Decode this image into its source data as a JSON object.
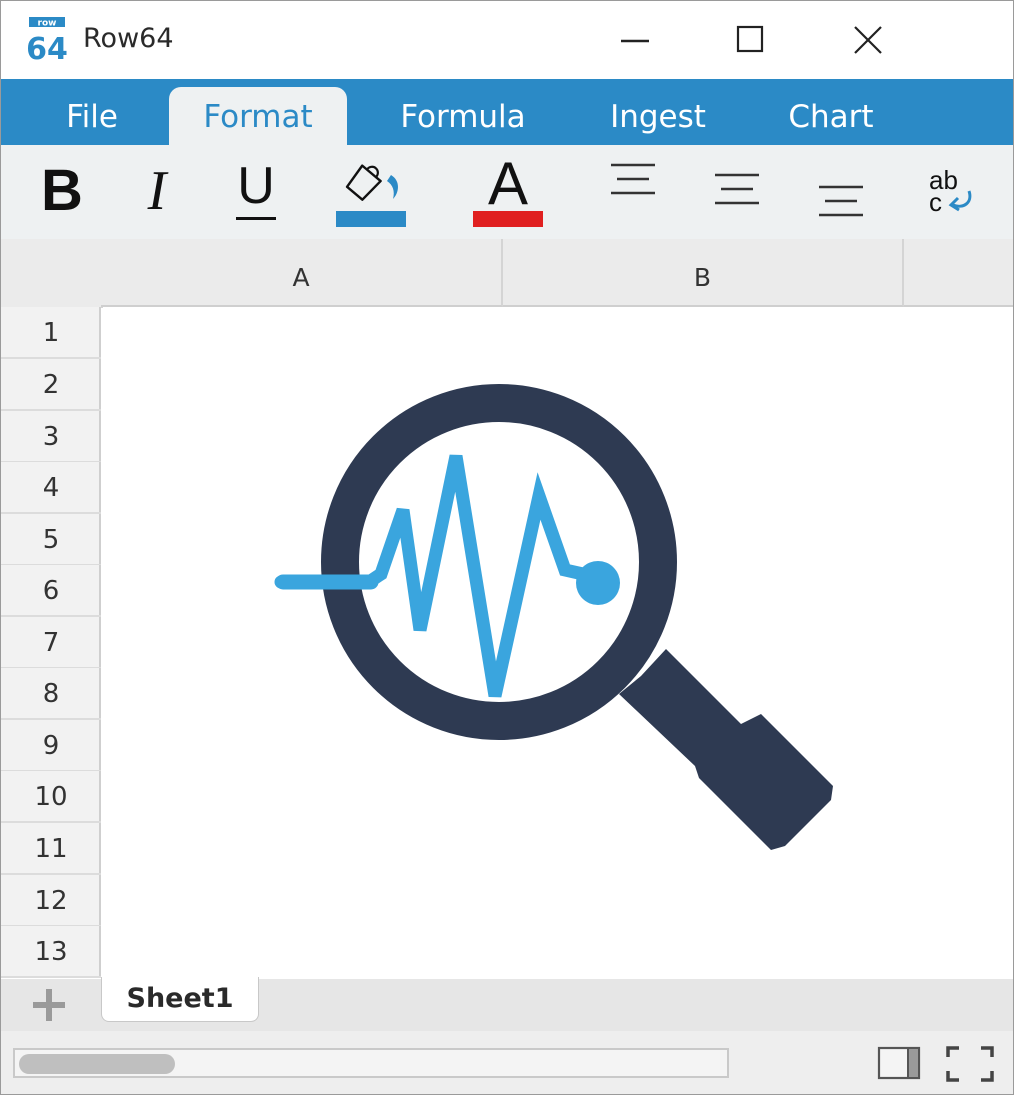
{
  "app": {
    "logo_top_text": "row",
    "logo_main_text": "64",
    "title": "Row64"
  },
  "window_controls": [
    "minimize",
    "maximize",
    "close"
  ],
  "tabs": [
    {
      "label": "File",
      "active": false
    },
    {
      "label": "Format",
      "active": true
    },
    {
      "label": "Formula",
      "active": false
    },
    {
      "label": "Ingest",
      "active": false
    },
    {
      "label": "Chart",
      "active": false
    }
  ],
  "toolbar": {
    "bold": "B",
    "italic": "I",
    "underline": "U",
    "fill_color_icon": "paint-bucket-icon",
    "fill_color": "#2b8ac6",
    "font_color_letter": "A",
    "font_color": "#e02020",
    "align_top_icon": "align-top-icon",
    "align_middle_icon": "align-middle-icon",
    "align_bottom_icon": "align-bottom-icon",
    "wrap_text_top": "ab",
    "wrap_text_bottom": "c"
  },
  "grid": {
    "columns": [
      "A",
      "B",
      ""
    ],
    "rows": [
      "1",
      "2",
      "3",
      "4",
      "5",
      "6",
      "7",
      "8",
      "9",
      "10",
      "11",
      "12",
      "13"
    ]
  },
  "embedded_image": {
    "icon": "magnifier-pulse-icon",
    "lens_color": "#2e3a52",
    "pulse_color": "#3aa5de"
  },
  "sheets": [
    {
      "label": "Sheet1",
      "active": true
    }
  ],
  "colors": {
    "accent": "#2b8ac6",
    "toolbar_bg": "#eef1f2",
    "header_bg": "#ebebeb"
  }
}
